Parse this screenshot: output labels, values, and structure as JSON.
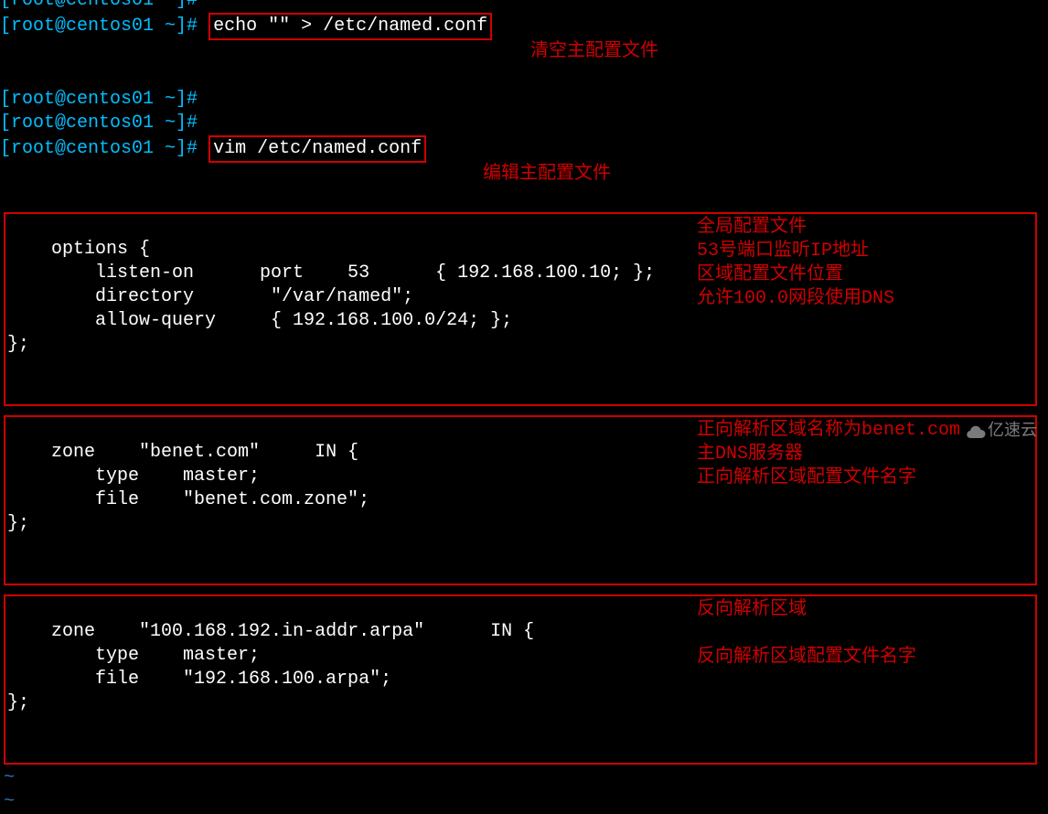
{
  "prompt_text": "[root@centos01 ~]#",
  "cmd1": "echo \"\" > /etc/named.conf",
  "annot1": "清空主配置文件",
  "cmd2": "vim /etc/named.conf",
  "annot2": "编辑主配置文件",
  "options_block": "options {\n        listen-on      port    53      { 192.168.100.10; };\n        directory       \"/var/named\";\n        allow-query     { 192.168.100.0/24; };\n};",
  "options_notes": {
    "n1": "全局配置文件",
    "n2": "53号端口监听IP地址",
    "n3": "区域配置文件位置",
    "n4": "允许100.0网段使用DNS"
  },
  "zone1_block": "zone    \"benet.com\"     IN {\n        type    master;\n        file    \"benet.com.zone\";\n};",
  "zone1_notes": {
    "n1": "正向解析区域名称为benet.com",
    "n2": "主DNS服务器",
    "n3": "正向解析区域配置文件名字"
  },
  "zone2_block": "zone    \"100.168.192.in-addr.arpa\"      IN {\n        type    master;\n        file    \"192.168.100.arpa\";\n};",
  "zone2_notes": {
    "n1": "反向解析区域",
    "n2": "反向解析区域配置文件名字"
  },
  "tilde": "~",
  "watermark": "亿速云"
}
